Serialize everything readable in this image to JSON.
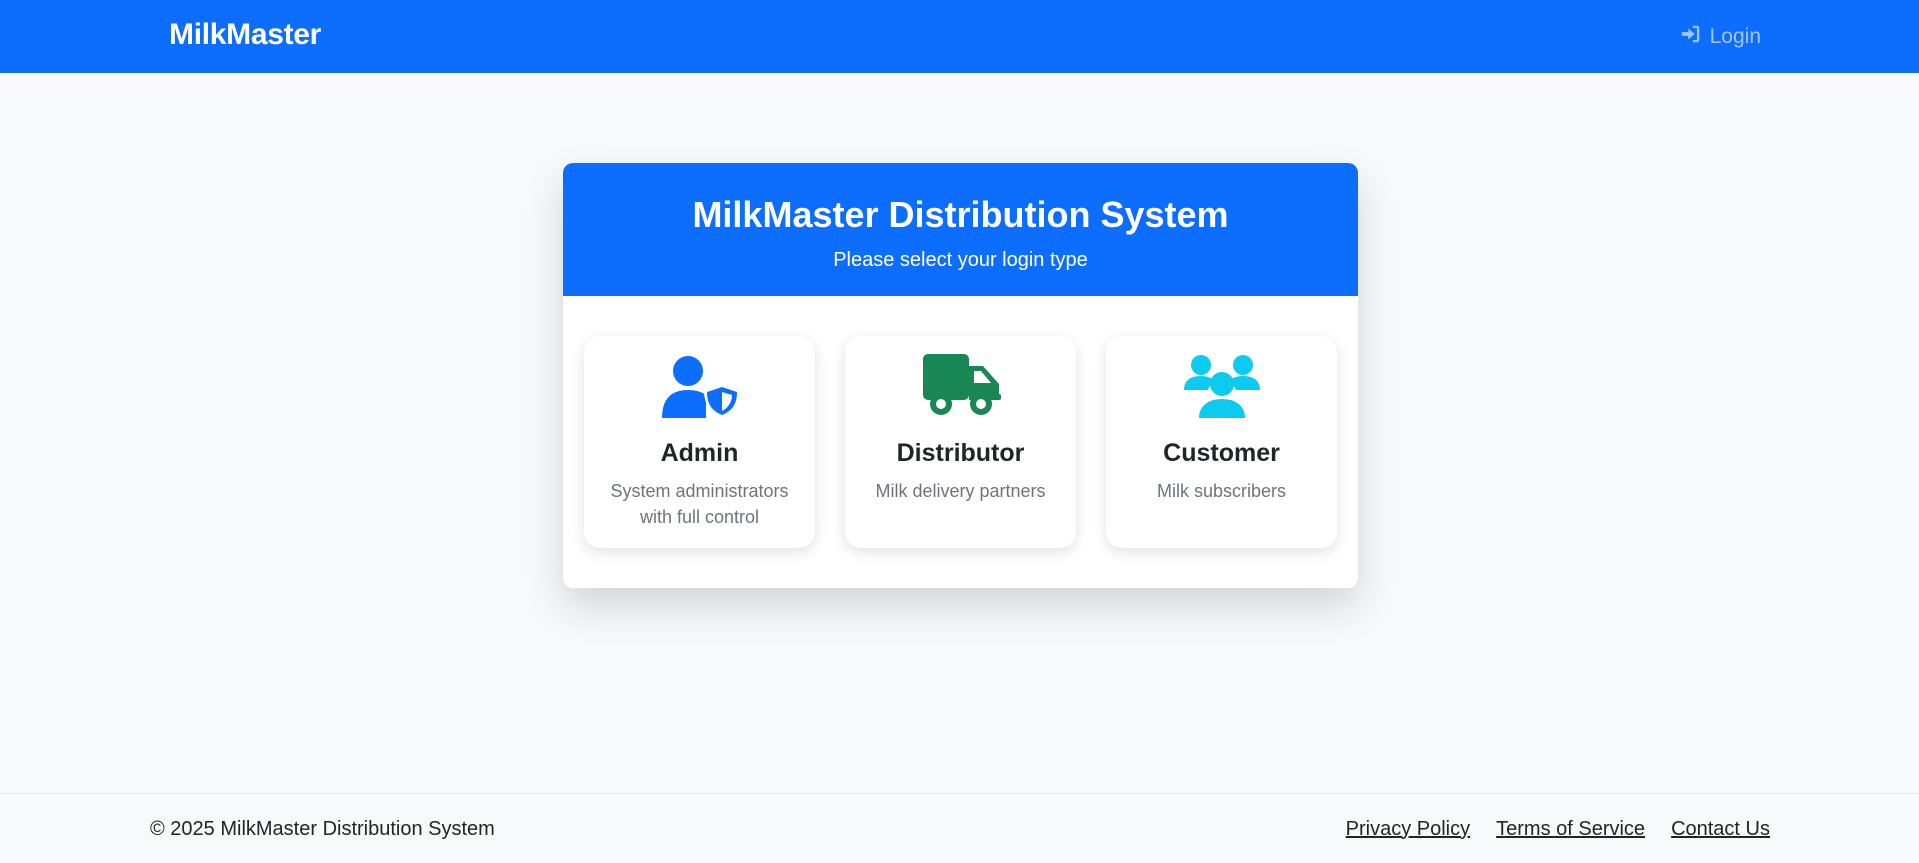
{
  "navbar": {
    "brand": "MilkMaster",
    "login_label": "Login",
    "login_icon": "sign-in-icon"
  },
  "card": {
    "title": "MilkMaster Distribution System",
    "subtitle": "Please select your login type",
    "options": [
      {
        "title": "Admin",
        "description": "System administrators with full control",
        "icon": "user-shield-icon",
        "color": "#0d6efd"
      },
      {
        "title": "Distributor",
        "description": "Milk delivery partners",
        "icon": "truck-icon",
        "color": "#198754"
      },
      {
        "title": "Customer",
        "description": "Milk subscribers",
        "icon": "users-icon",
        "color": "#0dcaf0"
      }
    ]
  },
  "footer": {
    "copyright": "© 2025 MilkMaster Distribution System",
    "links": [
      "Privacy Policy",
      "Terms of Service",
      "Contact Us"
    ]
  },
  "colors": {
    "primary": "#0d6efd",
    "success": "#198754",
    "info": "#0dcaf0",
    "background": "#f8f9fa"
  }
}
